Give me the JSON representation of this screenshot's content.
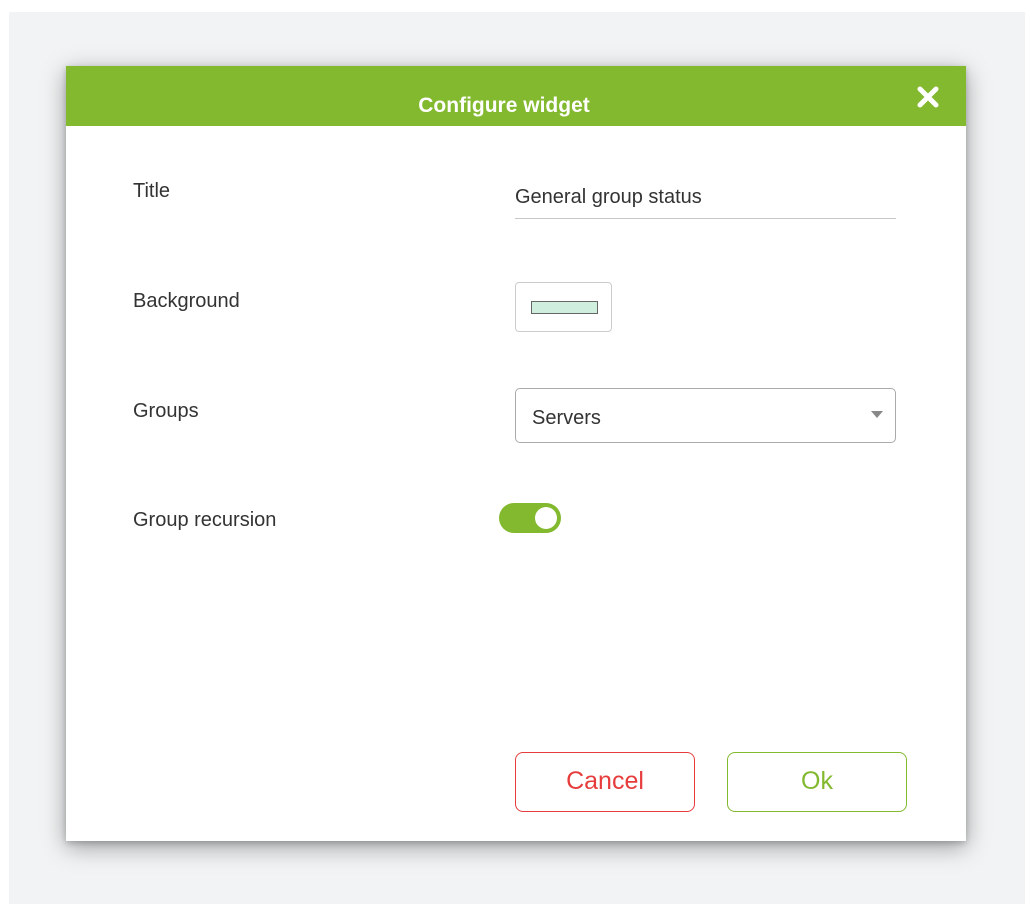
{
  "dialog": {
    "title": "Configure widget",
    "close_icon": "close-icon"
  },
  "form": {
    "title_label": "Title",
    "title_value": "General group status",
    "background_label": "Background",
    "background_color": "#cfeedd",
    "groups_label": "Groups",
    "groups_selected": "Servers",
    "recursion_label": "Group recursion",
    "recursion_enabled": true
  },
  "buttons": {
    "cancel_label": "Cancel",
    "ok_label": "Ok"
  },
  "colors": {
    "accent": "#82b92e",
    "danger": "#e63c3c"
  }
}
